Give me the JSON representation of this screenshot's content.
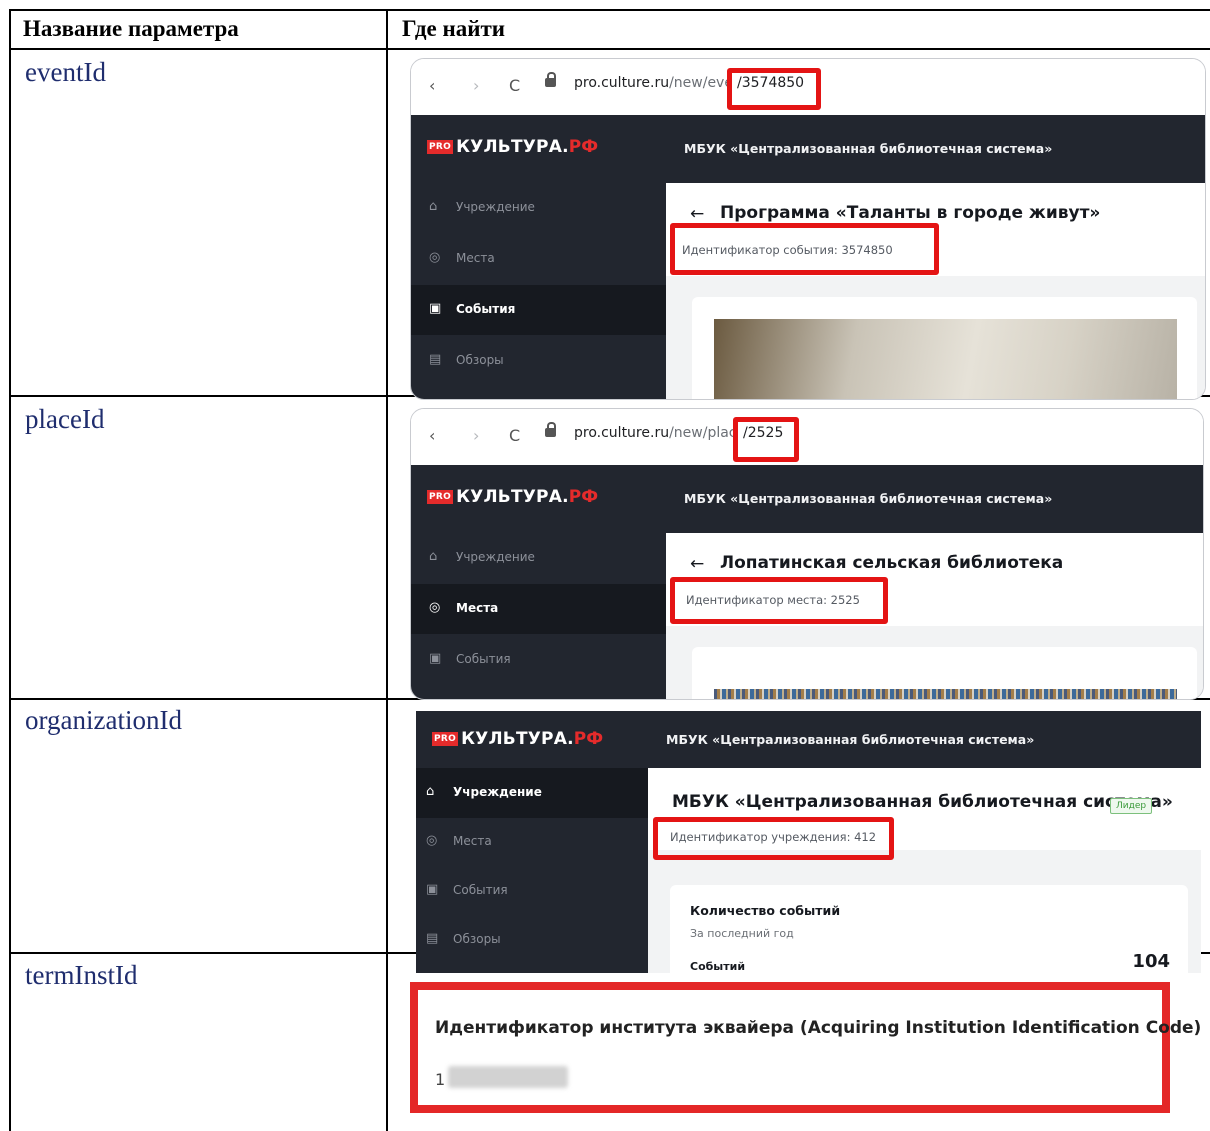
{
  "table": {
    "header": {
      "col1": "Название параметра",
      "col2": "Где найти"
    },
    "rows": [
      {
        "param": "eventId"
      },
      {
        "param": "placeId"
      },
      {
        "param": "organizationId"
      },
      {
        "param": "termInstId"
      }
    ]
  },
  "common": {
    "logo_pro": "PRO",
    "logo_main": "КУЛЬТУРА.",
    "logo_rf": "РФ",
    "org_title": "МБУК «Централизованная библиотечная система»",
    "nav_back": "‹",
    "nav_forward": "›",
    "nav_reload": "C",
    "back_arrow": "←",
    "sidebar_institution": "Учреждение",
    "sidebar_places": "Места",
    "sidebar_events": "События",
    "sidebar_reviews": "Обзоры",
    "icons": {
      "institution": "home-icon",
      "places": "location-pin-icon",
      "events": "calendar-icon",
      "reviews": "document-icon"
    }
  },
  "event_shot": {
    "url_domain": "pro.culture.ru",
    "url_path_start": "/new/even",
    "url_id": "/3574850",
    "page_title": "Программа «Таланты в городе живут»",
    "id_text": "Идентификатор события: 3574850"
  },
  "place_shot": {
    "url_domain": "pro.culture.ru",
    "url_path_start": "/new/plac",
    "url_id": "/2525",
    "page_title": "Лопатинская сельская библиотека",
    "id_text": "Идентификатор места: 2525"
  },
  "org_shot": {
    "page_title": "МБУК «Централизованная библиотечная система»",
    "badge": "Лидер",
    "id_text": "Идентификатор учреждения: 412",
    "card_title": "Количество событий",
    "card_sub": "За последний год",
    "card_label": "Событий",
    "card_value": "104"
  },
  "acq_shot": {
    "title": "Идентификатор института эквайера (Acquiring Institution Identification Code)",
    "value_visible": "1"
  },
  "colors": {
    "highlight": "#e41414",
    "dark_bg": "#22262f",
    "brand_red": "#e52b2b",
    "param_text": "#1f2d6e"
  }
}
